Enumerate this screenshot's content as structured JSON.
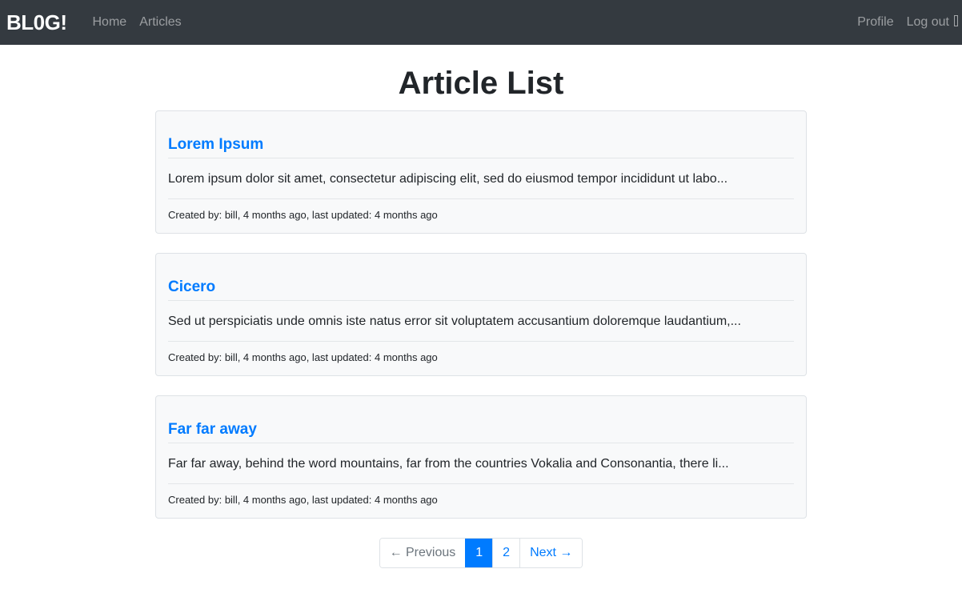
{
  "navbar": {
    "brand": "BL0G!",
    "links": [
      {
        "label": "Home"
      },
      {
        "label": "Articles"
      }
    ],
    "right_links": [
      {
        "label": "Profile"
      },
      {
        "label": "Log out"
      }
    ]
  },
  "main": {
    "title": "Article List",
    "articles": [
      {
        "title": "Lorem Ipsum",
        "excerpt": "Lorem ipsum dolor sit amet, consectetur adipiscing elit, sed do eiusmod tempor incididunt ut labo...",
        "meta": "Created by: bill, 4 months ago, last updated: 4 months ago"
      },
      {
        "title": "Cicero",
        "excerpt": "Sed ut perspiciatis unde omnis iste natus error sit voluptatem accusantium doloremque laudantium,...",
        "meta": "Created by: bill, 4 months ago, last updated: 4 months ago"
      },
      {
        "title": "Far far away",
        "excerpt": "Far far away, behind the word mountains, far from the countries Vokalia and Consonantia, there li...",
        "meta": "Created by: bill, 4 months ago, last updated: 4 months ago"
      }
    ]
  },
  "pagination": {
    "previous": "← Previous",
    "pages": [
      "1",
      "2"
    ],
    "current": "1",
    "next": "Next →"
  },
  "colors": {
    "navbar_bg": "#343a40",
    "link": "#007bff",
    "card_bg": "#f8f9fa"
  }
}
